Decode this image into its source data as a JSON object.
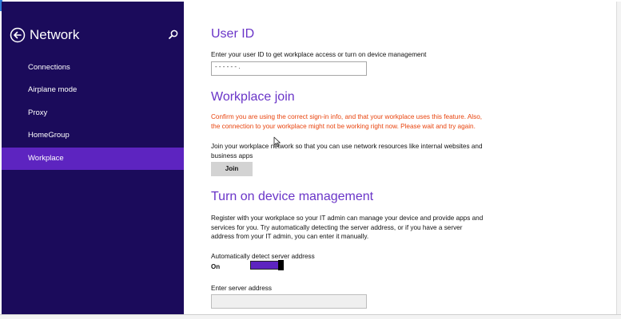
{
  "sidebar": {
    "title": "Network",
    "items": [
      {
        "label": "Connections"
      },
      {
        "label": "Airplane mode"
      },
      {
        "label": "Proxy"
      },
      {
        "label": "HomeGroup"
      },
      {
        "label": "Workplace",
        "active": true
      }
    ]
  },
  "user_id": {
    "heading": "User ID",
    "description": "Enter your user ID to get workplace access or turn on device management",
    "value": "-  -  -  -  -  -  ."
  },
  "workplace_join": {
    "heading": "Workplace join",
    "warning": "Confirm you are using the correct sign-in info, and that your workplace uses this feature. Also, the connection to your workplace might not be working right now. Please wait and try again.",
    "description": "Join your workplace network so that you can use network resources like internal websites and business apps",
    "join_label": "Join"
  },
  "device_management": {
    "heading": "Turn on device management",
    "description": "Register with your workplace so your IT admin can manage your device and provide apps and services for you. Try automatically detecting the server address, or if you have a server address from your IT admin, you can enter it manually.",
    "auto_detect_label": "Automatically detect server address",
    "toggle_state": "On",
    "server_address_label": "Enter server address",
    "server_address_value": ""
  },
  "colors": {
    "sidebar_bg": "#1b0b5b",
    "accent": "#5d24c0",
    "heading": "#6a35c8",
    "warning": "#e8430d"
  },
  "icons": [
    "back-arrow-icon",
    "search-icon",
    "mouse-cursor-icon"
  ]
}
